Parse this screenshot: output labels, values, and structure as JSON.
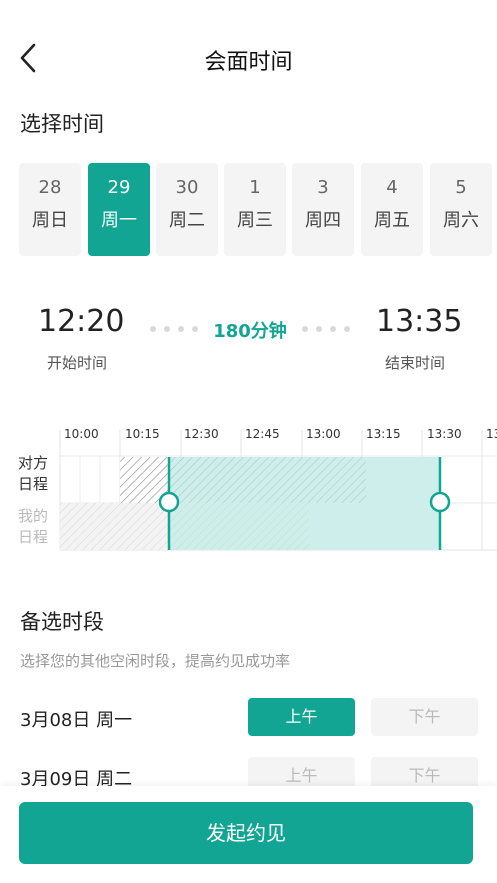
{
  "header": {
    "title": "会面时间",
    "back_icon": "chevron-left-icon"
  },
  "select_time": {
    "title": "选择时间",
    "dates": [
      {
        "day": "28",
        "weekday": "周日",
        "selected": false
      },
      {
        "day": "29",
        "weekday": "周一",
        "selected": true
      },
      {
        "day": "30",
        "weekday": "周二",
        "selected": false
      },
      {
        "day": "1",
        "weekday": "周三",
        "selected": false
      },
      {
        "day": "3",
        "weekday": "周四",
        "selected": false
      },
      {
        "day": "4",
        "weekday": "周五",
        "selected": false
      },
      {
        "day": "5",
        "weekday": "周六",
        "selected": false
      }
    ]
  },
  "range": {
    "start": "12:20",
    "start_label": "开始时间",
    "duration": "180分钟",
    "end": "13:35",
    "end_label": "结束时间"
  },
  "timeline": {
    "ticks": [
      "10:00",
      "10:15",
      "12:30",
      "12:45",
      "13:00",
      "13:15",
      "13:30",
      "13"
    ],
    "other_label": "对方\n日程",
    "mine_label": "我的\n日程"
  },
  "alternatives": {
    "title": "备选时段",
    "subtitle": "选择您的其他空闲时段，提高约见成功率",
    "rows": [
      {
        "date": "3月08日  周一",
        "am": "上午",
        "pm": "下午",
        "am_on": true,
        "pm_on": false
      },
      {
        "date": "3月09日  周二",
        "am": "上午",
        "pm": "下午",
        "am_on": false,
        "pm_on": false
      }
    ]
  },
  "footer": {
    "submit_label": "发起约见"
  },
  "colors": {
    "accent": "#12a594",
    "accent_light": "#cdeeea",
    "muted": "#f4f4f4"
  }
}
